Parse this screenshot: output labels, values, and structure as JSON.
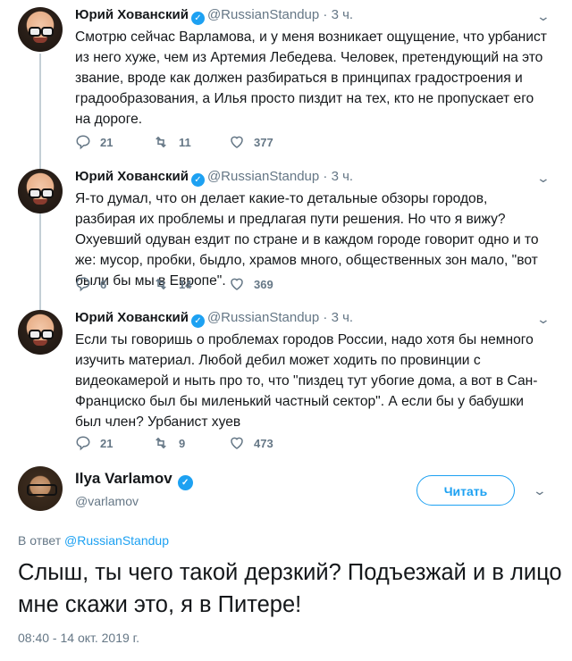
{
  "thread": [
    {
      "name": "Юрий Хованский",
      "handle": "@RussianStandup",
      "time": "· 3 ч.",
      "text": "Смотрю сейчас Варламова, и у меня возникает ощущение, что урбанист из него хуже, чем из Артемия Лебедева. Человек, претендующий на это звание, вроде как должен разбираться в принципах градостроения и градообразования, а Илья просто пиздит на тех, кто не пропускает его на дороге.",
      "replies": "21",
      "retweets": "11",
      "likes": "377"
    },
    {
      "name": "Юрий Хованский",
      "handle": "@RussianStandup",
      "time": "· 3 ч.",
      "text": "Я-то думал, что он делает какие-то детальные обзоры городов, разбирая их проблемы и предлагая пути решения. Но что я вижу? Охуевший одуван ездит по стране и в каждом городе говорит одно и то же: мусор, пробки, быдло, храмов много, общественных зон мало, \"вот были бы мы в Европе\".",
      "replies": "6",
      "retweets": "14",
      "likes": "369"
    },
    {
      "name": "Юрий Хованский",
      "handle": "@RussianStandup",
      "time": "· 3 ч.",
      "text": "Если ты говоришь о проблемах городов России, надо хотя бы немного изучить материал. Любой дебил может ходить по провинции с видеокамерой и ныть про то, что \"пиздец тут убогие дома, а вот в Сан-Франциско был бы миленький частный сектор\". А если бы у бабушки был член? Урбанист хуев",
      "replies": "21",
      "retweets": "9",
      "likes": "473"
    }
  ],
  "reply": {
    "name": "Ilya Varlamov",
    "handle": "@varlamov",
    "follow_label": "Читать",
    "reply_prefix": "В ответ",
    "reply_target": "@RussianStandup",
    "text": "Слыш, ты чего такой дерзкий? Подъезжай и в лицо мне скажи это, я в Питере!",
    "timestamp": "08:40 - 14 окт. 2019 г."
  },
  "icons": {
    "verified": "verified-badge-icon",
    "reply": "reply-icon",
    "retweet": "retweet-icon",
    "like": "heart-icon",
    "menu": "chevron-down-icon"
  },
  "colors": {
    "accent": "#1da1f2",
    "muted": "#657786",
    "text": "#14171a",
    "thread_line": "#c4cfd6"
  }
}
